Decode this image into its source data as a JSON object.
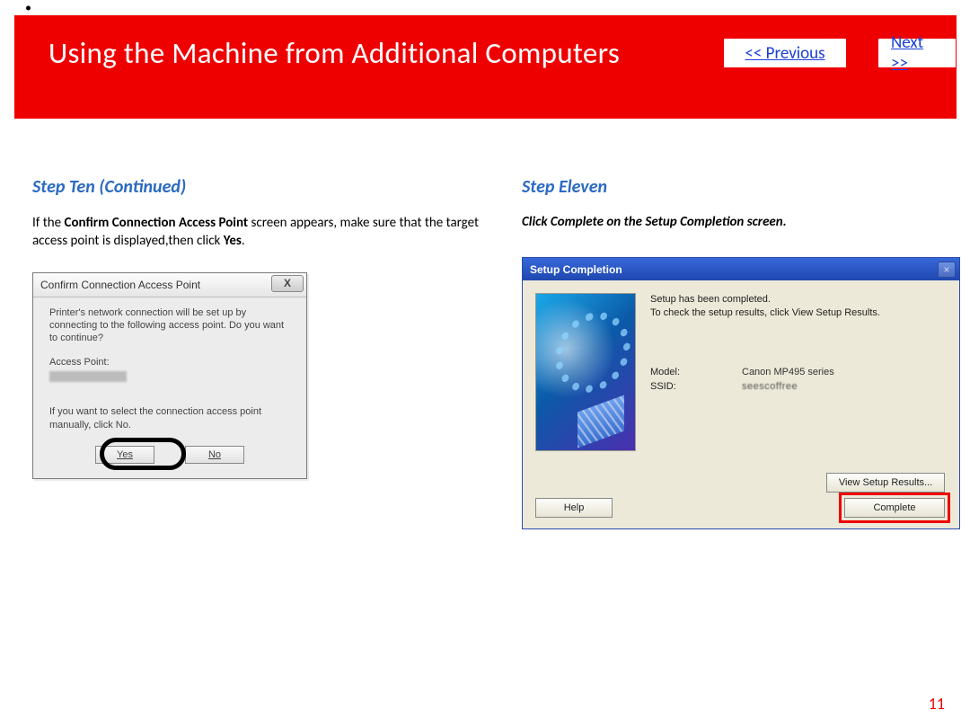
{
  "top_dot": "•",
  "header": {
    "title": "Using the Machine from Additional Computers",
    "prev": "<< Previous",
    "next": "Next >>"
  },
  "left": {
    "heading": "Step Ten (Continued)",
    "para_pre": "If the ",
    "para_b1": "Confirm Connection Access Point",
    "para_mid": " screen appears, make sure that the target access point is displayed,then click ",
    "para_b2": "Yes",
    "para_post": "."
  },
  "dialogA": {
    "title": "Confirm Connection Access Point",
    "close": "X",
    "line1": "Printer's network connection will be set up by connecting to the following access point. Do you want to continue?",
    "ap_label": "Access Point:",
    "line2": "If you want to select the connection access point manually, click No.",
    "yes": "Yes",
    "no": "No"
  },
  "right": {
    "heading": "Step Eleven",
    "instruction": "Click Complete on the Setup Completion screen."
  },
  "dialogB": {
    "title": "Setup Completion",
    "close": "×",
    "msg1": "Setup has been completed.",
    "msg2": "To check the setup results, click View Setup Results.",
    "model_k": "Model:",
    "model_v": "Canon MP495 series",
    "ssid_k": "SSID:",
    "ssid_v": "seescoffree",
    "view_results": "View Setup Results...",
    "help": "Help",
    "complete": "Complete"
  },
  "page_number": "11"
}
